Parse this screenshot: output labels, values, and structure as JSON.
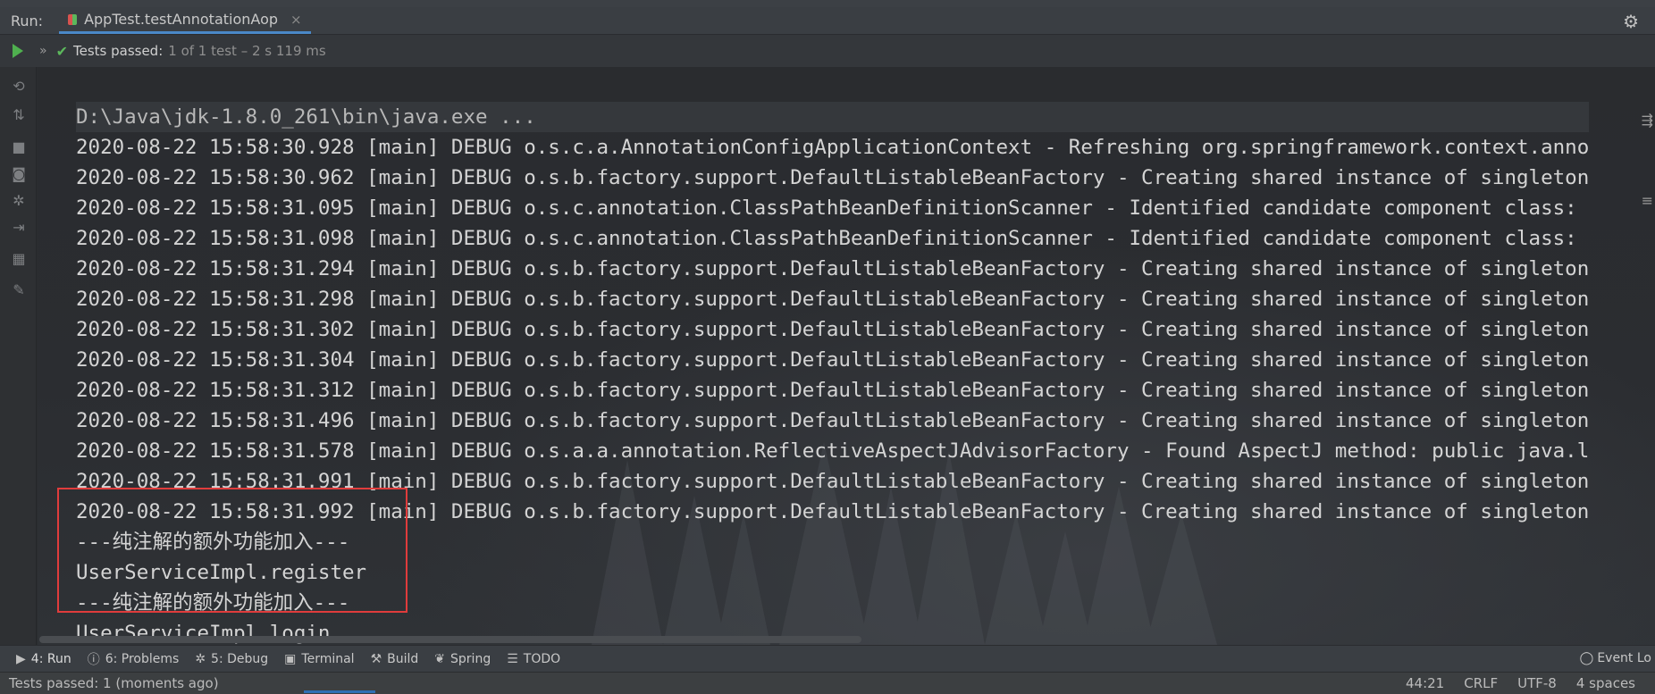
{
  "run_bar": {
    "label": "Run:",
    "tab_title": "AppTest.testAnnotationAop",
    "close_glyph": "×"
  },
  "status_row": {
    "summary": "Tests passed:",
    "detail": "1 of 1 test – 2 s 119 ms"
  },
  "console": {
    "lines": [
      "D:\\Java\\jdk-1.8.0_261\\bin\\java.exe ...",
      "2020-08-22 15:58:30.928 [main] DEBUG o.s.c.a.AnnotationConfigApplicationContext - Refreshing org.springframework.context.anno",
      "2020-08-22 15:58:30.962 [main] DEBUG o.s.b.factory.support.DefaultListableBeanFactory - Creating shared instance of singleton",
      "2020-08-22 15:58:31.095 [main] DEBUG o.s.c.annotation.ClassPathBeanDefinitionScanner - Identified candidate component class:",
      "2020-08-22 15:58:31.098 [main] DEBUG o.s.c.annotation.ClassPathBeanDefinitionScanner - Identified candidate component class:",
      "2020-08-22 15:58:31.294 [main] DEBUG o.s.b.factory.support.DefaultListableBeanFactory - Creating shared instance of singleton",
      "2020-08-22 15:58:31.298 [main] DEBUG o.s.b.factory.support.DefaultListableBeanFactory - Creating shared instance of singleton",
      "2020-08-22 15:58:31.302 [main] DEBUG o.s.b.factory.support.DefaultListableBeanFactory - Creating shared instance of singleton",
      "2020-08-22 15:58:31.304 [main] DEBUG o.s.b.factory.support.DefaultListableBeanFactory - Creating shared instance of singleton",
      "2020-08-22 15:58:31.312 [main] DEBUG o.s.b.factory.support.DefaultListableBeanFactory - Creating shared instance of singleton",
      "2020-08-22 15:58:31.496 [main] DEBUG o.s.b.factory.support.DefaultListableBeanFactory - Creating shared instance of singleton",
      "2020-08-22 15:58:31.578 [main] DEBUG o.s.a.a.annotation.ReflectiveAspectJAdvisorFactory - Found AspectJ method: public java.l",
      "2020-08-22 15:58:31.991 [main] DEBUG o.s.b.factory.support.DefaultListableBeanFactory - Creating shared instance of singleton",
      "2020-08-22 15:58:31.992 [main] DEBUG o.s.b.factory.support.DefaultListableBeanFactory - Creating shared instance of singleton",
      "---纯注解的额外功能加入---",
      "UserServiceImpl.register",
      "---纯注解的额外功能加入---",
      "UserServiceImpl.login"
    ]
  },
  "tool_windows": [
    {
      "label": "4: Run",
      "icon": "play-icon"
    },
    {
      "label": "6: Problems",
      "icon": "info-icon"
    },
    {
      "label": "5: Debug",
      "icon": "bug-icon"
    },
    {
      "label": "Terminal",
      "icon": "terminal-icon"
    },
    {
      "label": "Build",
      "icon": "hammer-icon"
    },
    {
      "label": "Spring",
      "icon": "leaf-icon"
    },
    {
      "label": "TODO",
      "icon": "list-icon"
    }
  ],
  "event_log": "Event Lo",
  "status_bar": {
    "message": "Tests passed: 1 (moments ago)",
    "position": "44:21",
    "line_separator": "CRLF",
    "encoding": "UTF-8",
    "indent": "4 spaces"
  },
  "colors": {
    "accent": "#4a88c7",
    "pass_green": "#5cb85c",
    "highlight_red": "#e03c3c"
  }
}
